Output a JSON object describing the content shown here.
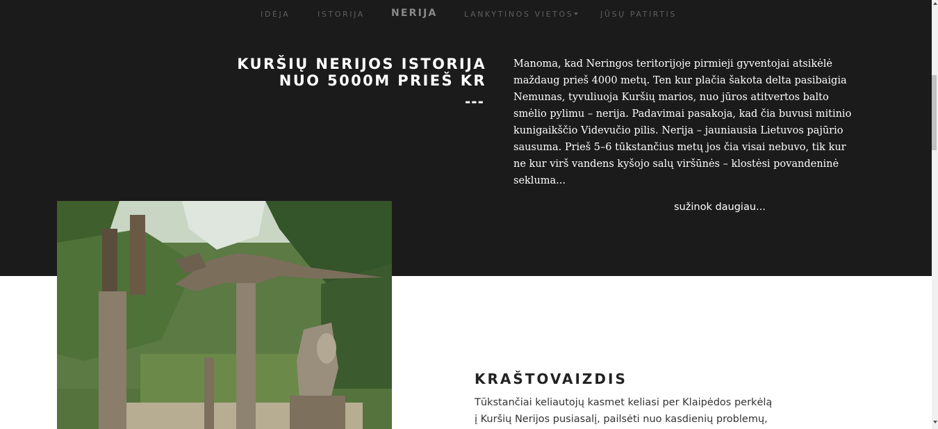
{
  "nav": {
    "items": [
      "IDĖJA",
      "ISTORIJA",
      "NERIJA",
      "LANKYTINOS VIETOS",
      "JŪSŲ PATIRTIS"
    ],
    "active": "NERIJA"
  },
  "history": {
    "title_line1": "KURŠIŲ NERIJOS ISTORIJA",
    "title_line2": "NUO 5000M PRIEŠ KR",
    "dashes": "---",
    "paragraph": "Manoma, kad Neringos teritorijoje pirmieji gyventojai atsikėlė maždaug prieš 4000 metų. Ten kur plačia šakota delta pasibaigia Nemunas, tyvuliuoja Kuršių marios, nuo jūros atitvertos balto smėlio pylimu – nerija. Padavimai pasakoja, kad čia buvusi mitinio kunigaikščio Videvučio pilis. Nerija – jauniausia Lietuvos pajūrio sausuma. Prieš 5–6 tūkstančius metų jos čia visai nebuvo, tik kur ne kur virš vandens kyšojo salų viršūnės – klostėsi povandeninė sekluma...",
    "more_link": "sužinok daugiau..."
  },
  "landscape": {
    "title": "KRAŠTOVAIZDIS",
    "paragraph": "Tūkstančiai keliautojų kasmet keliasi per Klaipėdos perkėlą į Kuršių Nerijos pusiasalį, pailsėti nuo kasdienių problemų,"
  },
  "photo": {
    "icon": "carved-wooden-sculptures-photo"
  },
  "colors": {
    "dark_background": "#1c1b1c",
    "nav_text": "#5f5e5f",
    "nav_active": "#8a898a",
    "light_background": "#ffffff"
  }
}
